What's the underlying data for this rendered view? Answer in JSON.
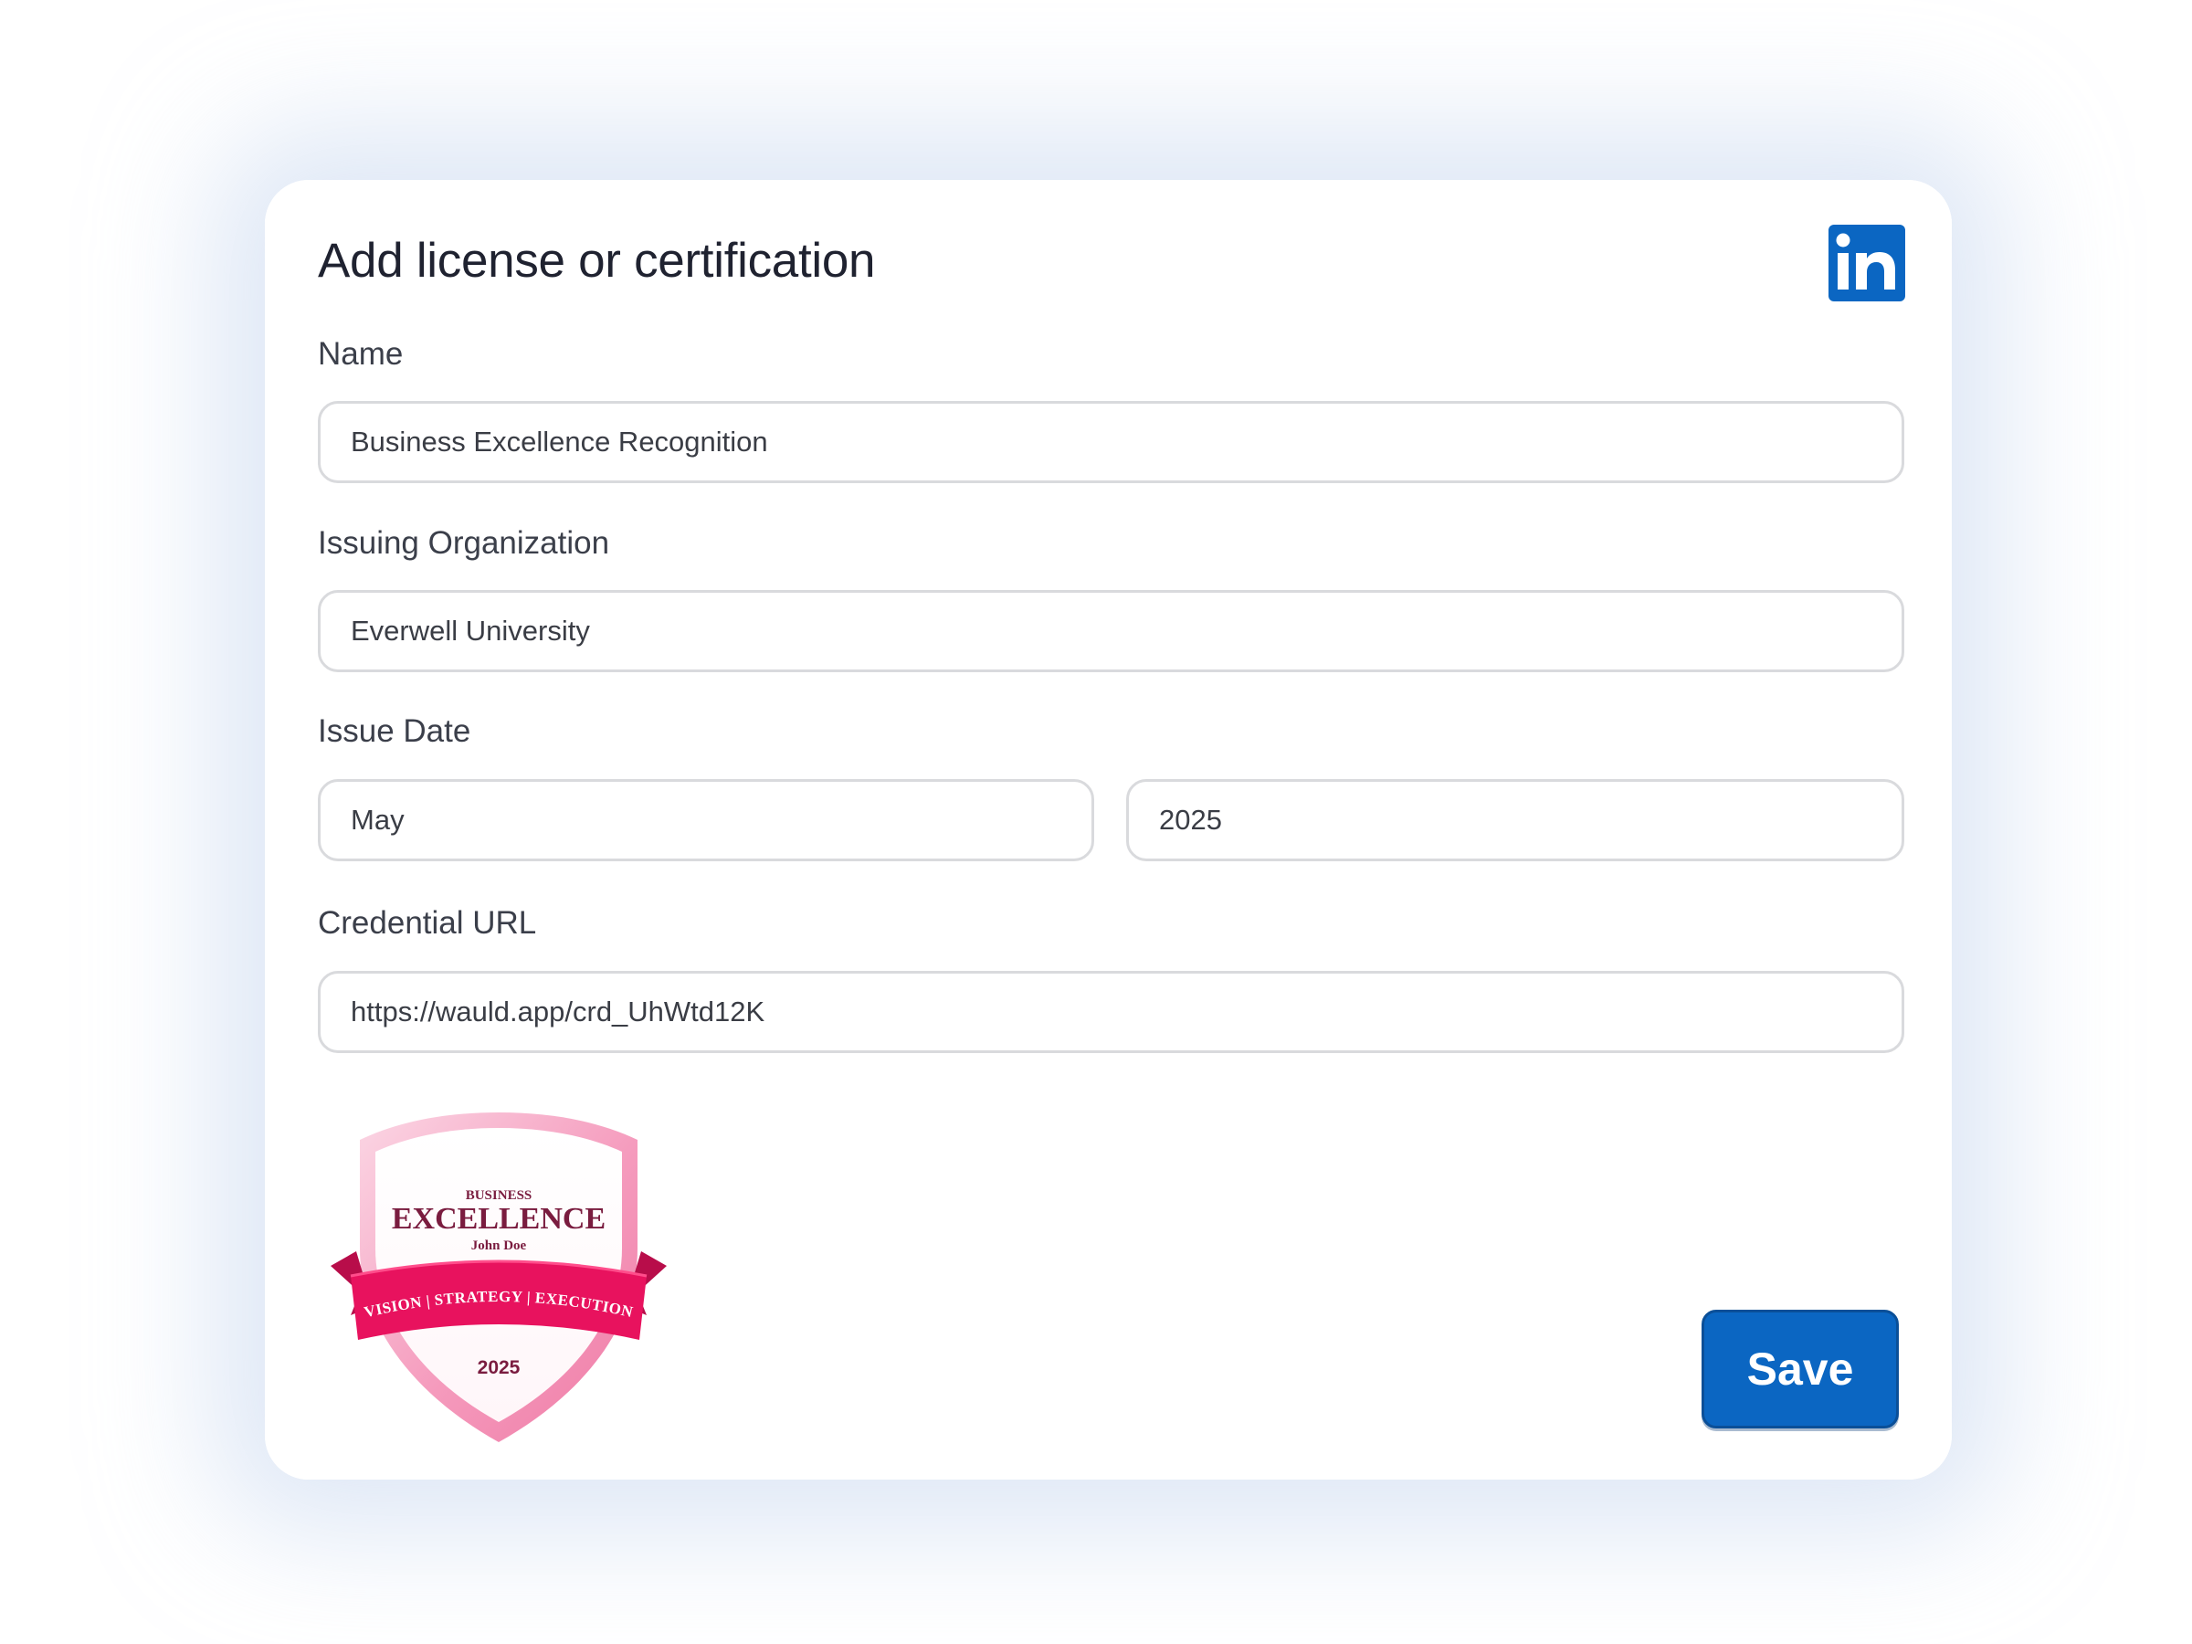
{
  "dialog": {
    "title": "Add license or certification",
    "brand_icon": "linkedin-logo",
    "brand_color": "#0b66c2"
  },
  "fields": {
    "name": {
      "label": "Name",
      "value": "Business Excellence Recognition"
    },
    "issuing_org": {
      "label": "Issuing Organization",
      "value": "Everwell University"
    },
    "issue_date": {
      "label": "Issue Date",
      "month": "May",
      "year": "2025"
    },
    "credential_url": {
      "label": "Credential URL",
      "value": "https://wauld.app/crd_UhWtd12K"
    }
  },
  "badge": {
    "line1": "BUSINESS",
    "line2": "EXCELLENCE",
    "recipient": "John Doe",
    "ribbon_text": "VISION | STRATEGY | EXECUTION",
    "year": "2025",
    "colors": {
      "ribbon": "#e8125e",
      "text": "#7a1c3f",
      "shield": "#f48fb1"
    }
  },
  "actions": {
    "save_label": "Save",
    "save_color": "#0b66c2"
  }
}
